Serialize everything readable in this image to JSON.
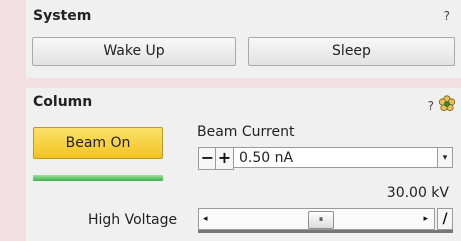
{
  "system": {
    "title": "System",
    "help": "?",
    "wake_label": "Wake Up",
    "sleep_label": "Sleep"
  },
  "column": {
    "title": "Column",
    "help": "?",
    "beam_on_label": "Beam On",
    "beam_current_label": "Beam Current",
    "minus": "−",
    "plus": "+",
    "beam_current_value": "0.50 nA",
    "high_voltage_label": "High Voltage",
    "kv_readout": "30.00 kV",
    "slider_left": "◂",
    "slider_thumb": "⏸",
    "slider_right": "▸",
    "toggle_char": "/",
    "dropdown_arrow": "▾"
  },
  "colors": {
    "background": "#f3dfe1",
    "panel": "#f0f0f0",
    "beam_on": "#f2c41f",
    "beam_status": "#3bb24a"
  },
  "icons": {
    "help": "question-mark-icon",
    "settings": "flower-icon"
  }
}
